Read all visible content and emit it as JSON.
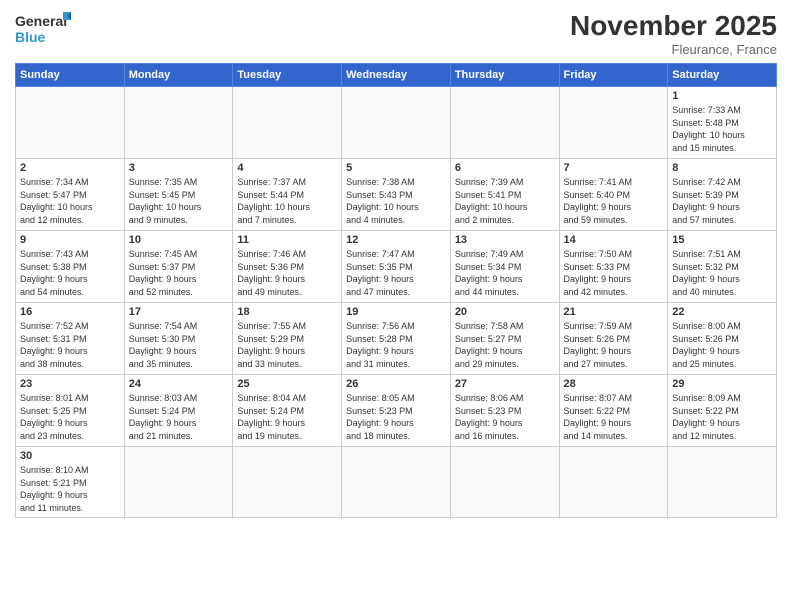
{
  "logo": {
    "text_general": "General",
    "text_blue": "Blue"
  },
  "title": "November 2025",
  "location": "Fleurance, France",
  "days_of_week": [
    "Sunday",
    "Monday",
    "Tuesday",
    "Wednesday",
    "Thursday",
    "Friday",
    "Saturday"
  ],
  "weeks": [
    [
      {
        "day": "",
        "info": ""
      },
      {
        "day": "",
        "info": ""
      },
      {
        "day": "",
        "info": ""
      },
      {
        "day": "",
        "info": ""
      },
      {
        "day": "",
        "info": ""
      },
      {
        "day": "",
        "info": ""
      },
      {
        "day": "1",
        "info": "Sunrise: 7:33 AM\nSunset: 5:48 PM\nDaylight: 10 hours\nand 15 minutes."
      }
    ],
    [
      {
        "day": "2",
        "info": "Sunrise: 7:34 AM\nSunset: 5:47 PM\nDaylight: 10 hours\nand 12 minutes."
      },
      {
        "day": "3",
        "info": "Sunrise: 7:35 AM\nSunset: 5:45 PM\nDaylight: 10 hours\nand 9 minutes."
      },
      {
        "day": "4",
        "info": "Sunrise: 7:37 AM\nSunset: 5:44 PM\nDaylight: 10 hours\nand 7 minutes."
      },
      {
        "day": "5",
        "info": "Sunrise: 7:38 AM\nSunset: 5:43 PM\nDaylight: 10 hours\nand 4 minutes."
      },
      {
        "day": "6",
        "info": "Sunrise: 7:39 AM\nSunset: 5:41 PM\nDaylight: 10 hours\nand 2 minutes."
      },
      {
        "day": "7",
        "info": "Sunrise: 7:41 AM\nSunset: 5:40 PM\nDaylight: 9 hours\nand 59 minutes."
      },
      {
        "day": "8",
        "info": "Sunrise: 7:42 AM\nSunset: 5:39 PM\nDaylight: 9 hours\nand 57 minutes."
      }
    ],
    [
      {
        "day": "9",
        "info": "Sunrise: 7:43 AM\nSunset: 5:38 PM\nDaylight: 9 hours\nand 54 minutes."
      },
      {
        "day": "10",
        "info": "Sunrise: 7:45 AM\nSunset: 5:37 PM\nDaylight: 9 hours\nand 52 minutes."
      },
      {
        "day": "11",
        "info": "Sunrise: 7:46 AM\nSunset: 5:36 PM\nDaylight: 9 hours\nand 49 minutes."
      },
      {
        "day": "12",
        "info": "Sunrise: 7:47 AM\nSunset: 5:35 PM\nDaylight: 9 hours\nand 47 minutes."
      },
      {
        "day": "13",
        "info": "Sunrise: 7:49 AM\nSunset: 5:34 PM\nDaylight: 9 hours\nand 44 minutes."
      },
      {
        "day": "14",
        "info": "Sunrise: 7:50 AM\nSunset: 5:33 PM\nDaylight: 9 hours\nand 42 minutes."
      },
      {
        "day": "15",
        "info": "Sunrise: 7:51 AM\nSunset: 5:32 PM\nDaylight: 9 hours\nand 40 minutes."
      }
    ],
    [
      {
        "day": "16",
        "info": "Sunrise: 7:52 AM\nSunset: 5:31 PM\nDaylight: 9 hours\nand 38 minutes."
      },
      {
        "day": "17",
        "info": "Sunrise: 7:54 AM\nSunset: 5:30 PM\nDaylight: 9 hours\nand 35 minutes."
      },
      {
        "day": "18",
        "info": "Sunrise: 7:55 AM\nSunset: 5:29 PM\nDaylight: 9 hours\nand 33 minutes."
      },
      {
        "day": "19",
        "info": "Sunrise: 7:56 AM\nSunset: 5:28 PM\nDaylight: 9 hours\nand 31 minutes."
      },
      {
        "day": "20",
        "info": "Sunrise: 7:58 AM\nSunset: 5:27 PM\nDaylight: 9 hours\nand 29 minutes."
      },
      {
        "day": "21",
        "info": "Sunrise: 7:59 AM\nSunset: 5:26 PM\nDaylight: 9 hours\nand 27 minutes."
      },
      {
        "day": "22",
        "info": "Sunrise: 8:00 AM\nSunset: 5:26 PM\nDaylight: 9 hours\nand 25 minutes."
      }
    ],
    [
      {
        "day": "23",
        "info": "Sunrise: 8:01 AM\nSunset: 5:25 PM\nDaylight: 9 hours\nand 23 minutes."
      },
      {
        "day": "24",
        "info": "Sunrise: 8:03 AM\nSunset: 5:24 PM\nDaylight: 9 hours\nand 21 minutes."
      },
      {
        "day": "25",
        "info": "Sunrise: 8:04 AM\nSunset: 5:24 PM\nDaylight: 9 hours\nand 19 minutes."
      },
      {
        "day": "26",
        "info": "Sunrise: 8:05 AM\nSunset: 5:23 PM\nDaylight: 9 hours\nand 18 minutes."
      },
      {
        "day": "27",
        "info": "Sunrise: 8:06 AM\nSunset: 5:23 PM\nDaylight: 9 hours\nand 16 minutes."
      },
      {
        "day": "28",
        "info": "Sunrise: 8:07 AM\nSunset: 5:22 PM\nDaylight: 9 hours\nand 14 minutes."
      },
      {
        "day": "29",
        "info": "Sunrise: 8:09 AM\nSunset: 5:22 PM\nDaylight: 9 hours\nand 12 minutes."
      }
    ],
    [
      {
        "day": "30",
        "info": "Sunrise: 8:10 AM\nSunset: 5:21 PM\nDaylight: 9 hours\nand 11 minutes."
      },
      {
        "day": "",
        "info": ""
      },
      {
        "day": "",
        "info": ""
      },
      {
        "day": "",
        "info": ""
      },
      {
        "day": "",
        "info": ""
      },
      {
        "day": "",
        "info": ""
      },
      {
        "day": "",
        "info": ""
      }
    ]
  ]
}
